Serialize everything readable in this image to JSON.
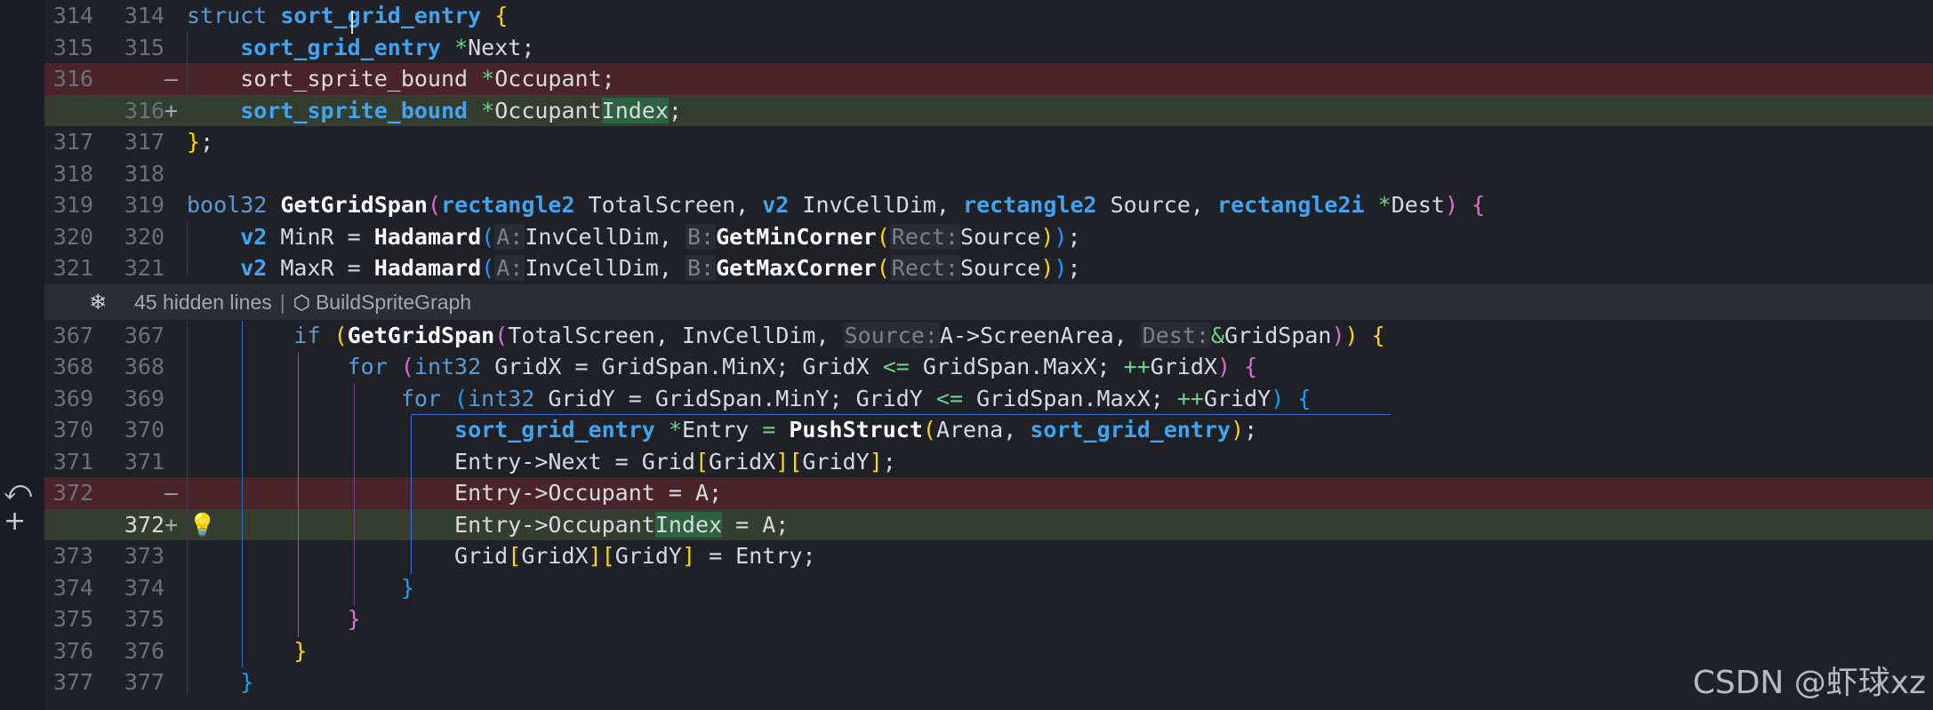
{
  "left_strip": {
    "undo_icon": "undo-arrow-icon",
    "plus_icon": "plus-icon"
  },
  "fold": {
    "icon": "snowflake-expand-icon",
    "hidden_lines_label": "45 hidden lines",
    "separator": "|",
    "symbol_icon": "cube-icon",
    "symbol_name": "BuildSpriteGraph"
  },
  "watermark": "CSDN @虾球xz",
  "colors": {
    "deleted_row_bg": "#4a242b",
    "added_row_bg": "#353d2f",
    "keyword": "#5b9bd5",
    "type": "#3fa4f2",
    "operator": "#6dd18a"
  },
  "lines": [
    {
      "old": "314",
      "new": "314",
      "sign": "",
      "tokens": [
        "struct",
        "sort_grid_entry",
        "{"
      ]
    },
    {
      "old": "315",
      "new": "315",
      "sign": "",
      "tokens": [
        "sort_grid_entry",
        "*",
        "Next;"
      ]
    },
    {
      "old": "316",
      "new": "",
      "sign": "—",
      "tokens": [
        "sort_sprite_bound",
        "*",
        "Occupant;"
      ]
    },
    {
      "old": "",
      "new": "316",
      "sign": "+",
      "tokens": [
        "sort_sprite_bound",
        "*",
        "Occupant",
        "Index",
        ";"
      ]
    },
    {
      "old": "317",
      "new": "317",
      "sign": "",
      "tokens": [
        "}",
        ";"
      ]
    },
    {
      "old": "318",
      "new": "318",
      "sign": "",
      "tokens": []
    },
    {
      "old": "319",
      "new": "319",
      "sign": "",
      "tokens": [
        "bool32",
        "GetGridSpan",
        "(",
        "rectangle2",
        " TotalScreen, ",
        "v2",
        " InvCellDim, ",
        "rectangle2",
        " Source, ",
        "rectangle2i",
        "*",
        "Dest",
        ")",
        "{"
      ]
    },
    {
      "old": "320",
      "new": "320",
      "sign": "",
      "tokens": [
        "v2",
        " MinR = ",
        "Hadamard",
        "(",
        "A:",
        "InvCellDim, ",
        "B:",
        "GetMinCorner",
        "(",
        "Rect:",
        "Source",
        ")",
        ")",
        ";"
      ]
    },
    {
      "old": "321",
      "new": "321",
      "sign": "",
      "tokens": [
        "v2",
        " MaxR = ",
        "Hadamard",
        "(",
        "A:",
        "InvCellDim, ",
        "B:",
        "GetMaxCorner",
        "(",
        "Rect:",
        "Source",
        ")",
        ")",
        ";"
      ]
    },
    {
      "old": "367",
      "new": "367",
      "sign": "",
      "tokens": [
        "if",
        "(",
        "GetGridSpan",
        "(",
        "TotalScreen, InvCellDim, ",
        "Source:",
        "A->ScreenArea, ",
        "Dest:",
        "&",
        "GridSpan",
        ")",
        ")",
        "{"
      ]
    },
    {
      "old": "368",
      "new": "368",
      "sign": "",
      "tokens": [
        "for",
        "(",
        "int32",
        " GridX = GridSpan.MinX; GridX ",
        "<=",
        " GridSpan.MaxX; ",
        "++",
        "GridX",
        ")",
        "{"
      ]
    },
    {
      "old": "369",
      "new": "369",
      "sign": "",
      "tokens": [
        "for",
        "(",
        "int32",
        " GridY = GridSpan.MinY; GridY ",
        "<=",
        " GridSpan.MaxX; ",
        "++",
        "GridY",
        ")",
        "{"
      ]
    },
    {
      "old": "370",
      "new": "370",
      "sign": "",
      "tokens": [
        "sort_grid_entry",
        "*",
        "Entry ",
        "=",
        "PushStruct",
        "(",
        "Arena, ",
        "sort_grid_entry",
        ")",
        ";"
      ]
    },
    {
      "old": "371",
      "new": "371",
      "sign": "",
      "tokens": [
        "Entry->Next = Grid",
        "[",
        "GridX",
        "]",
        "[",
        "GridY",
        "]",
        ";"
      ]
    },
    {
      "old": "372",
      "new": "",
      "sign": "—",
      "tokens": [
        "Entry->Occupant = A;"
      ]
    },
    {
      "old": "",
      "new": "372",
      "sign": "+",
      "tokens": [
        "Entry->",
        "Occupant",
        "Index",
        " = A;"
      ]
    },
    {
      "old": "373",
      "new": "373",
      "sign": "",
      "tokens": [
        "Grid",
        "[",
        "GridX",
        "]",
        "[",
        "GridY",
        "]",
        " = Entry;"
      ]
    },
    {
      "old": "374",
      "new": "374",
      "sign": "",
      "tokens": [
        "}"
      ]
    },
    {
      "old": "375",
      "new": "375",
      "sign": "",
      "tokens": [
        "}"
      ]
    },
    {
      "old": "376",
      "new": "376",
      "sign": "",
      "tokens": [
        "}"
      ]
    },
    {
      "old": "377",
      "new": "377",
      "sign": "",
      "tokens": [
        "}"
      ]
    }
  ]
}
